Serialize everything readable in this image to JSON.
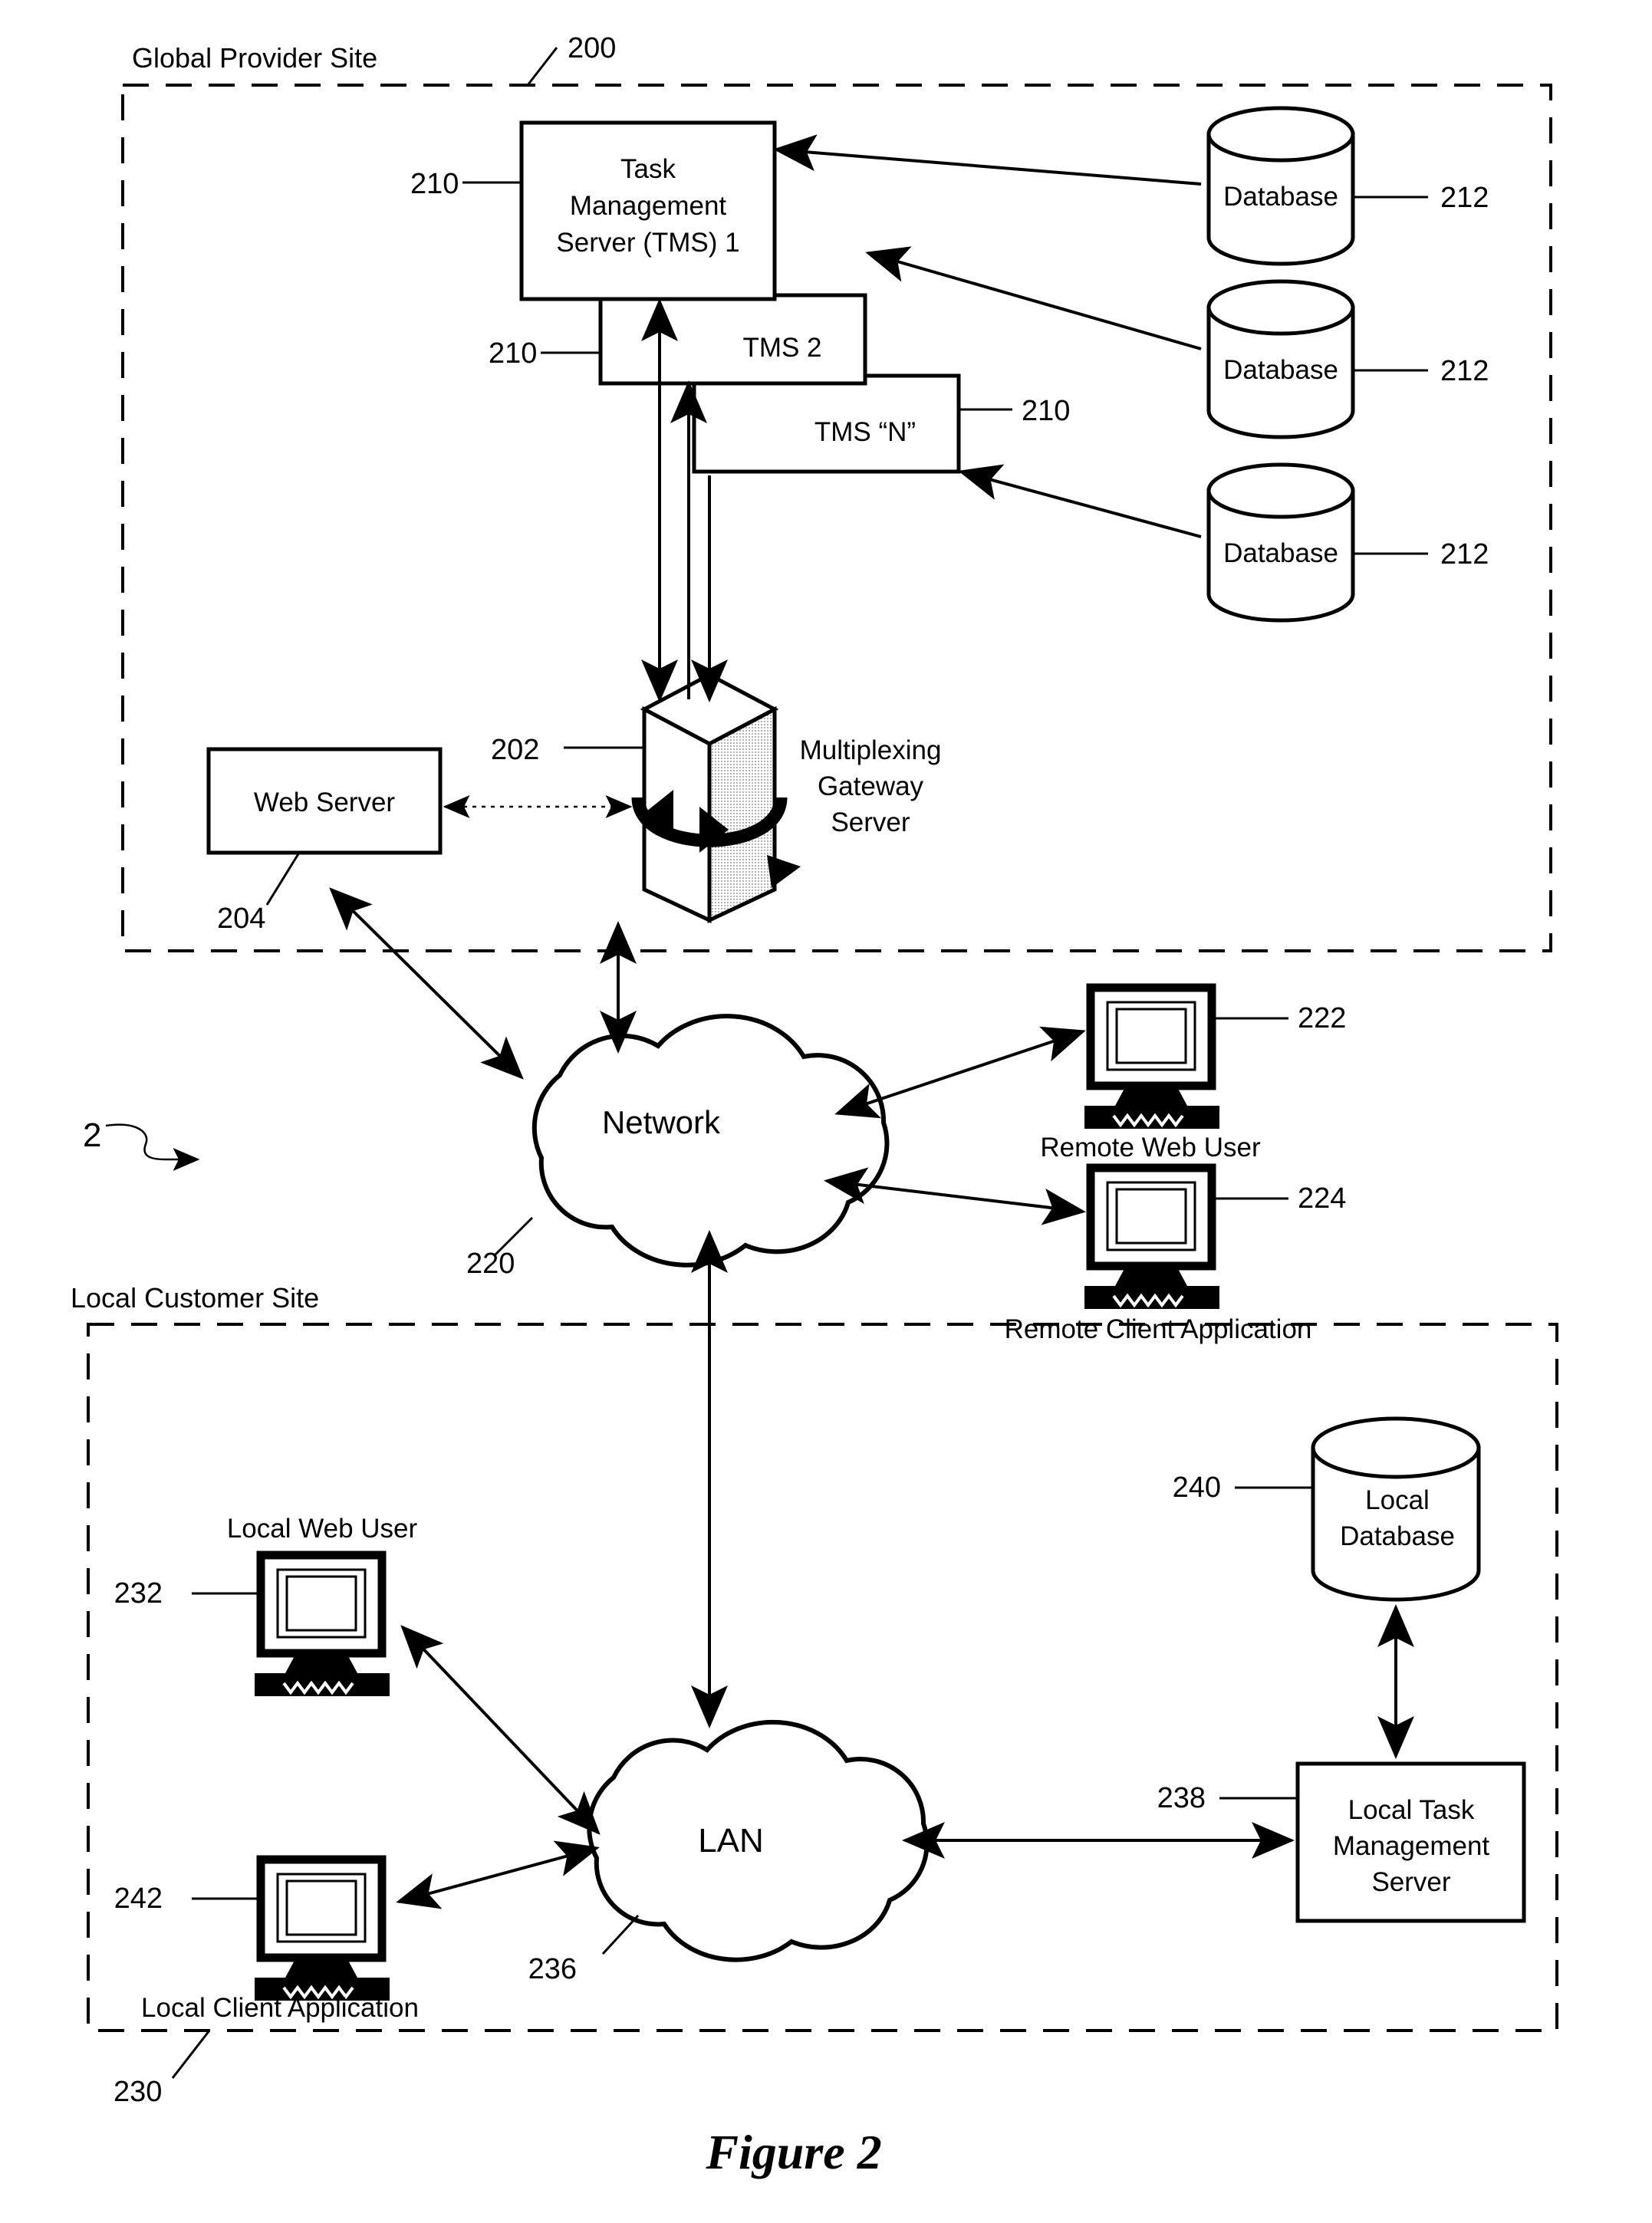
{
  "figure": {
    "caption": "Figure 2",
    "system_ref": "2"
  },
  "sites": {
    "global": {
      "title": "Global Provider Site",
      "ref": "200"
    },
    "local": {
      "title": "Local Customer Site",
      "ref": "230"
    }
  },
  "nodes": {
    "tms1": {
      "label": "Task Management Server (TMS) 1",
      "line1": "Task",
      "line2": "Management",
      "line3": "Server (TMS) 1",
      "ref": "210"
    },
    "tms2": {
      "label": "TMS 2",
      "ref": "210"
    },
    "tmsn": {
      "label": "TMS “N”",
      "ref": "210"
    },
    "database1": {
      "label": "Database",
      "ref": "212"
    },
    "database2": {
      "label": "Database",
      "ref": "212"
    },
    "database3": {
      "label": "Database",
      "ref": "212"
    },
    "mux_gateway": {
      "line1": "Multiplexing",
      "line2": "Gateway",
      "line3": "Server",
      "ref": "202"
    },
    "web_server": {
      "label": "Web Server",
      "ref": "204"
    },
    "network": {
      "label": "Network",
      "ref": "220"
    },
    "remote_web_user": {
      "label": "Remote Web User",
      "ref": "222"
    },
    "remote_client_app": {
      "label": "Remote Client Application",
      "ref": "224"
    },
    "local_web_user": {
      "label": "Local Web User",
      "ref": "232"
    },
    "local_client_app": {
      "label": "Local Client Application",
      "ref": "242"
    },
    "lan": {
      "label": "LAN",
      "ref": "236"
    },
    "local_database": {
      "line1": "Local",
      "line2": "Database",
      "ref": "240"
    },
    "local_tms": {
      "line1": "Local Task",
      "line2": "Management",
      "line3": "Server",
      "ref": "238"
    }
  },
  "colors": {
    "ink": "#000000",
    "paper": "#ffffff"
  }
}
